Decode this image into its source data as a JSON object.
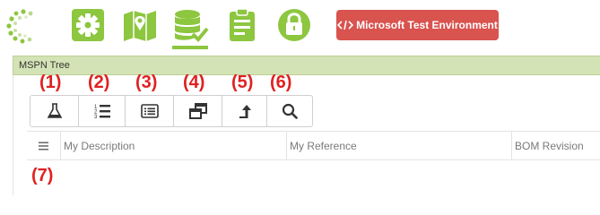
{
  "nav": {
    "items": [
      {
        "icon": "gear-icon"
      },
      {
        "icon": "map-icon"
      },
      {
        "icon": "database-check-icon",
        "active": true
      },
      {
        "icon": "clipboard-icon"
      },
      {
        "icon": "lock-icon"
      }
    ],
    "environment_label": "Microsoft Test Environment",
    "environment_icon": "code-icon"
  },
  "panel": {
    "title": "MSPN Tree"
  },
  "toolbar": {
    "buttons": [
      {
        "icon": "flask-icon",
        "annotation": "(1)"
      },
      {
        "icon": "numbered-list-icon",
        "annotation": "(2)"
      },
      {
        "icon": "list-view-icon",
        "annotation": "(3)"
      },
      {
        "icon": "windows-icon",
        "annotation": "(4)"
      },
      {
        "icon": "arrow-up-icon",
        "annotation": "(5)"
      },
      {
        "icon": "search-icon",
        "annotation": "(6)"
      }
    ]
  },
  "grid": {
    "menu_icon": "hamburger-icon",
    "menu_annotation": "(7)",
    "columns": [
      "My Description",
      "My Reference",
      "BOM Revision"
    ]
  },
  "colors": {
    "accent_green": "#8dc63f",
    "header_green": "#d4e3b5",
    "env_red": "#d9534f",
    "annotation_red": "#e02020"
  }
}
